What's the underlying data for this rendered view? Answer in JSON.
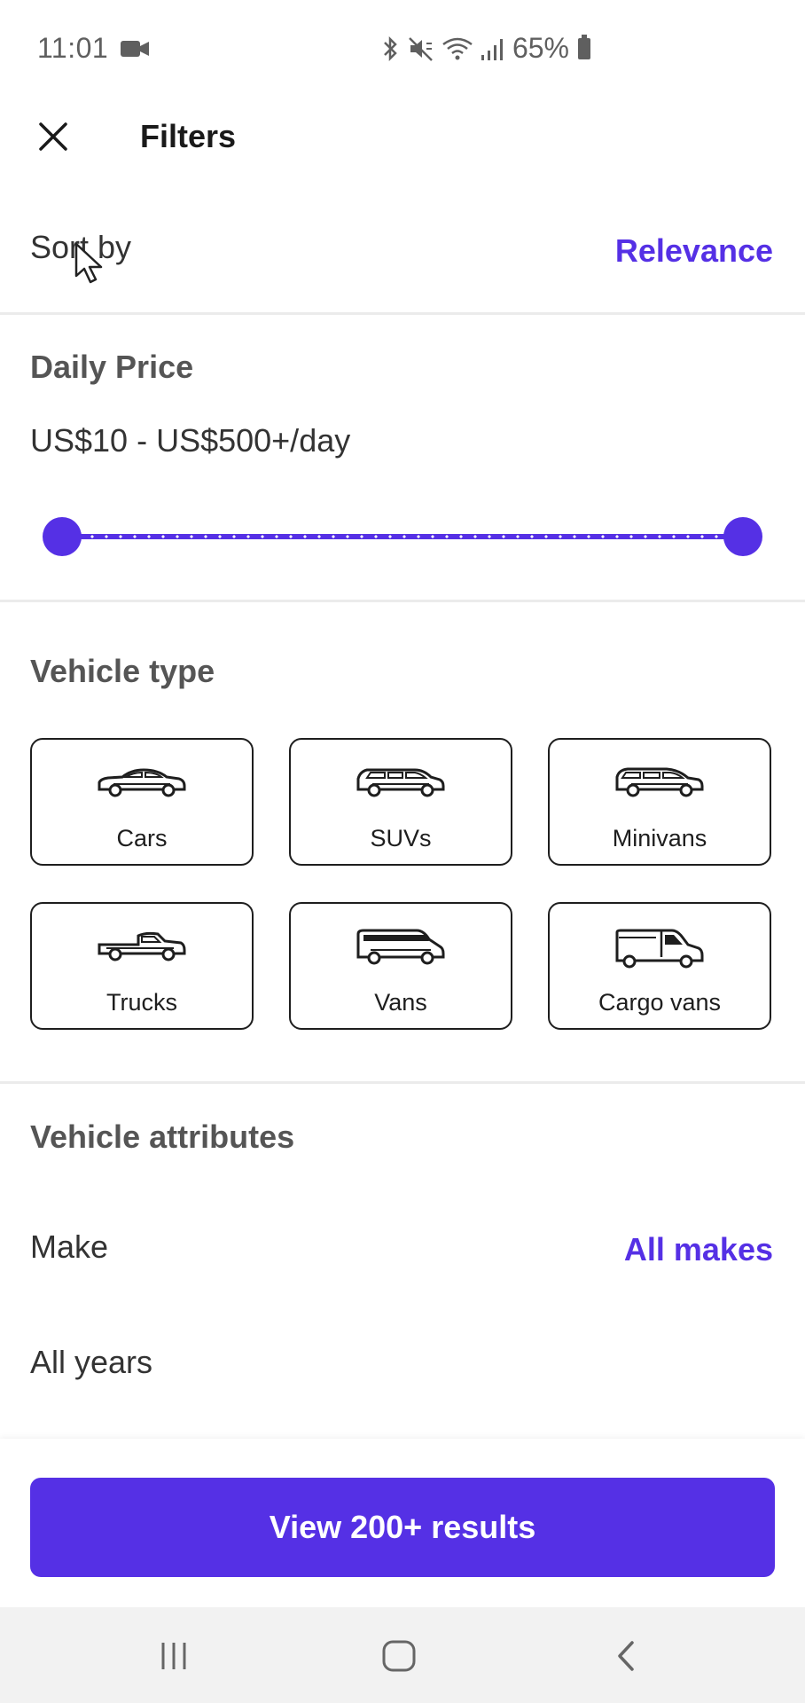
{
  "status_bar": {
    "time": "11:01",
    "battery": "65%",
    "icons": [
      "video-icon",
      "bluetooth-icon",
      "mute-icon",
      "wifi-icon",
      "signal-icon",
      "battery-icon"
    ]
  },
  "header": {
    "title": "Filters",
    "close_icon": "close-icon"
  },
  "sort": {
    "label": "Sort by",
    "value": "Relevance"
  },
  "price": {
    "title": "Daily Price",
    "range_text": "US$10 - US$500+/day",
    "min_fraction": 0.0,
    "max_fraction": 1.0
  },
  "vehicle_type": {
    "title": "Vehicle type",
    "items": [
      {
        "label": "Cars",
        "icon": "car-icon"
      },
      {
        "label": "SUVs",
        "icon": "suv-icon"
      },
      {
        "label": "Minivans",
        "icon": "minivan-icon"
      },
      {
        "label": "Trucks",
        "icon": "truck-icon"
      },
      {
        "label": "Vans",
        "icon": "van-icon"
      },
      {
        "label": "Cargo vans",
        "icon": "cargo-van-icon"
      }
    ]
  },
  "vehicle_attributes": {
    "title": "Vehicle attributes",
    "make_label": "Make",
    "make_value": "All makes",
    "years_label": "All years"
  },
  "cta": {
    "label": "View 200+ results"
  },
  "colors": {
    "accent": "#5530e5",
    "text": "#333333",
    "divider": "#ebebeb"
  }
}
